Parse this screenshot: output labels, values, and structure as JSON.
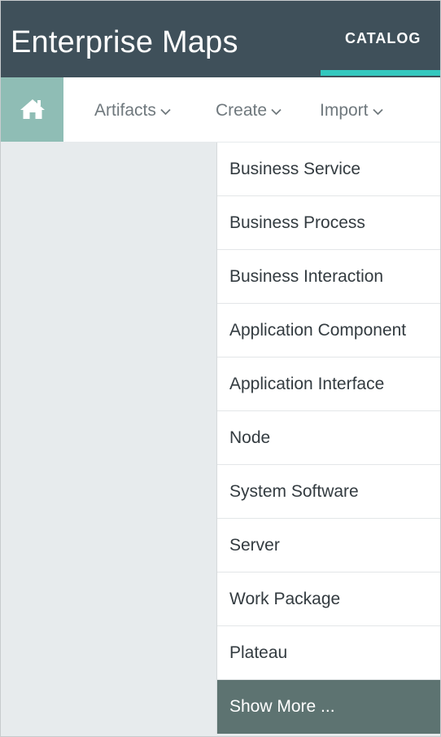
{
  "header": {
    "app_title": "Enterprise Maps",
    "tab_label": "CATALOG",
    "accent_color": "#33c7be",
    "background_color": "#3f505a"
  },
  "toolbar": {
    "home_icon": "home-icon",
    "menus": [
      {
        "label": "Artifacts",
        "icon": "chevron-down-icon"
      },
      {
        "label": "Create",
        "icon": "chevron-down-icon"
      },
      {
        "label": "Import",
        "icon": "chevron-down-icon"
      }
    ]
  },
  "create_menu": {
    "items": [
      "Business Service",
      "Business Process",
      "Business Interaction",
      "Application Component",
      "Application Interface",
      "Node",
      "System Software",
      "Server",
      "Work Package",
      "Plateau"
    ],
    "show_more_label": "Show More ..."
  }
}
